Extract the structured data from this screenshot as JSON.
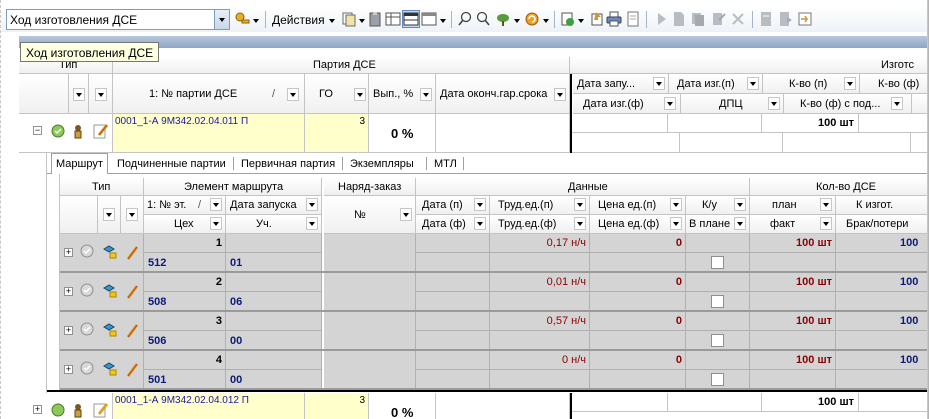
{
  "toolbar": {
    "view_select_value": "Ход изготовления ДСЕ",
    "actions_label": "Действия"
  },
  "tooltip": "Ход изготовления ДСЕ",
  "outer_grid": {
    "header": {
      "type_group": "Тип",
      "batch_group": "Партия ДСЕ",
      "manuf_group": "Изготс",
      "batch_no_col": "1: № партии ДСЕ",
      "sort_arrow": "/",
      "go_col": "ГО",
      "done_col": "Вып., %",
      "guar_col": "Дата оконч.гар.срока",
      "start_date_col": "Дата запу...",
      "mf_plan_col": "Дата изг.(п)",
      "qty_plan_col": "К-во (п)",
      "qty_fact_col_cut": "К-во (ф)",
      "mf_fact_col": "Дата изг.(ф)",
      "dpc_col": "ДПЦ",
      "qty_sub_col": "К-во (ф) с под..."
    },
    "rows": [
      {
        "expand": "−",
        "batch_no": "0001_1-А 9М342.02.04.011 П",
        "go": "3",
        "done": "0 %",
        "qty_plan": "100 шт"
      },
      {
        "expand": "+",
        "batch_no": "0001_1-А 9М342.02.04.012 П",
        "go": "3",
        "done": "0 %",
        "qty_plan": "100 шт"
      }
    ]
  },
  "tabs": [
    {
      "label": "Маршрут",
      "active": true
    },
    {
      "label": "Подчиненные партии",
      "active": false
    },
    {
      "label": "Первичная партия",
      "active": false
    },
    {
      "label": "Экземпляры",
      "active": false
    },
    {
      "label": "МТЛ",
      "active": false
    }
  ],
  "inner_grid": {
    "header": {
      "type_group": "Тип",
      "route_group": "Элемент маршрута",
      "order_group": "Наряд-заказ",
      "data_group": "Данные",
      "qty_group": "Кол-во ДСЕ",
      "step_no": "1: № эт.",
      "sort_arrow": "/",
      "start_date": "Дата запуска",
      "shop": "Цех",
      "section": "Уч.",
      "order_no": "№",
      "date_p": "Дата (п)",
      "date_f": "Дата (ф)",
      "labor_p": "Труд.ед.(п)",
      "labor_f": "Труд.ед.(ф)",
      "price_p": "Цена ед.(п)",
      "price_f": "Цена ед.(ф)",
      "ku": "К/у",
      "in_plan": "В плане",
      "plan": "план",
      "fact": "факт",
      "to_make": "К изгот.",
      "defect": "Брак/потери"
    },
    "rows": [
      {
        "step": "1",
        "shop": "512",
        "section": "01",
        "labor": "0,17 н/ч",
        "price": "0",
        "plan_qty": "100 шт",
        "to_make": "100"
      },
      {
        "step": "2",
        "shop": "508",
        "section": "06",
        "labor": "0,01 н/ч",
        "price": "0",
        "plan_qty": "100 шт",
        "to_make": "100"
      },
      {
        "step": "3",
        "shop": "506",
        "section": "00",
        "labor": "0,57 н/ч",
        "price": "0",
        "plan_qty": "100 шт",
        "to_make": "100"
      },
      {
        "step": "4",
        "shop": "501",
        "section": "00",
        "labor": "0 н/ч",
        "price": "0",
        "plan_qty": "100 шт",
        "to_make": "100"
      }
    ]
  }
}
